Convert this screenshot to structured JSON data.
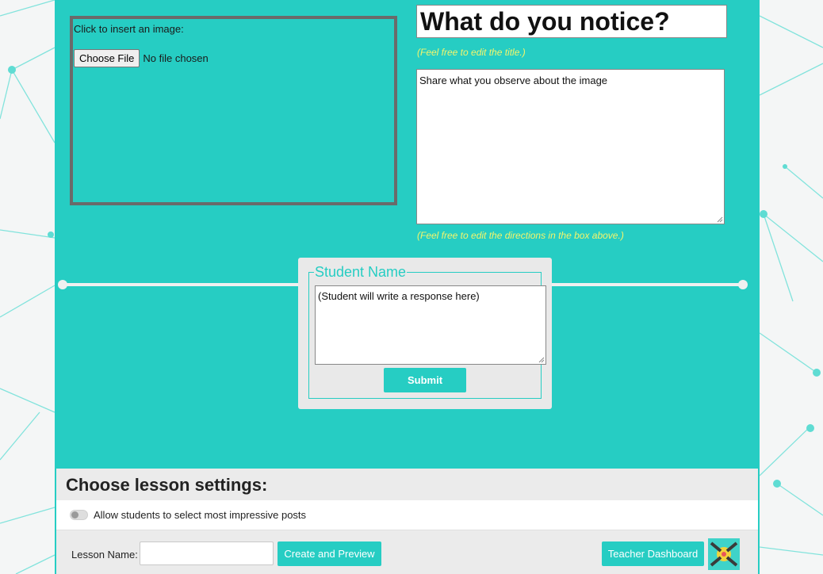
{
  "image_area": {
    "label": "Click to insert an image:",
    "file_button": "Choose File",
    "file_status": "No file chosen"
  },
  "prompt": {
    "title": "What do you notice?",
    "title_hint": "(Feel free to edit the title.)",
    "directions": "Share what you observe about the image",
    "directions_hint": "(Feel free to edit the directions in the box above.)"
  },
  "student_card": {
    "legend": "Student Name",
    "response_placeholder": "(Student will write a response here)",
    "submit_label": "Submit"
  },
  "settings": {
    "heading": "Choose lesson settings:",
    "toggle_label": "Allow students to select most impressive posts",
    "lesson_name_label": "Lesson Name:",
    "lesson_name_value": "",
    "create_label": "Create and Preview",
    "dashboard_label": "Teacher Dashboard"
  },
  "colors": {
    "accent": "#26cdc3",
    "hint": "#f3f56c",
    "frame": "#6a6a6a"
  }
}
